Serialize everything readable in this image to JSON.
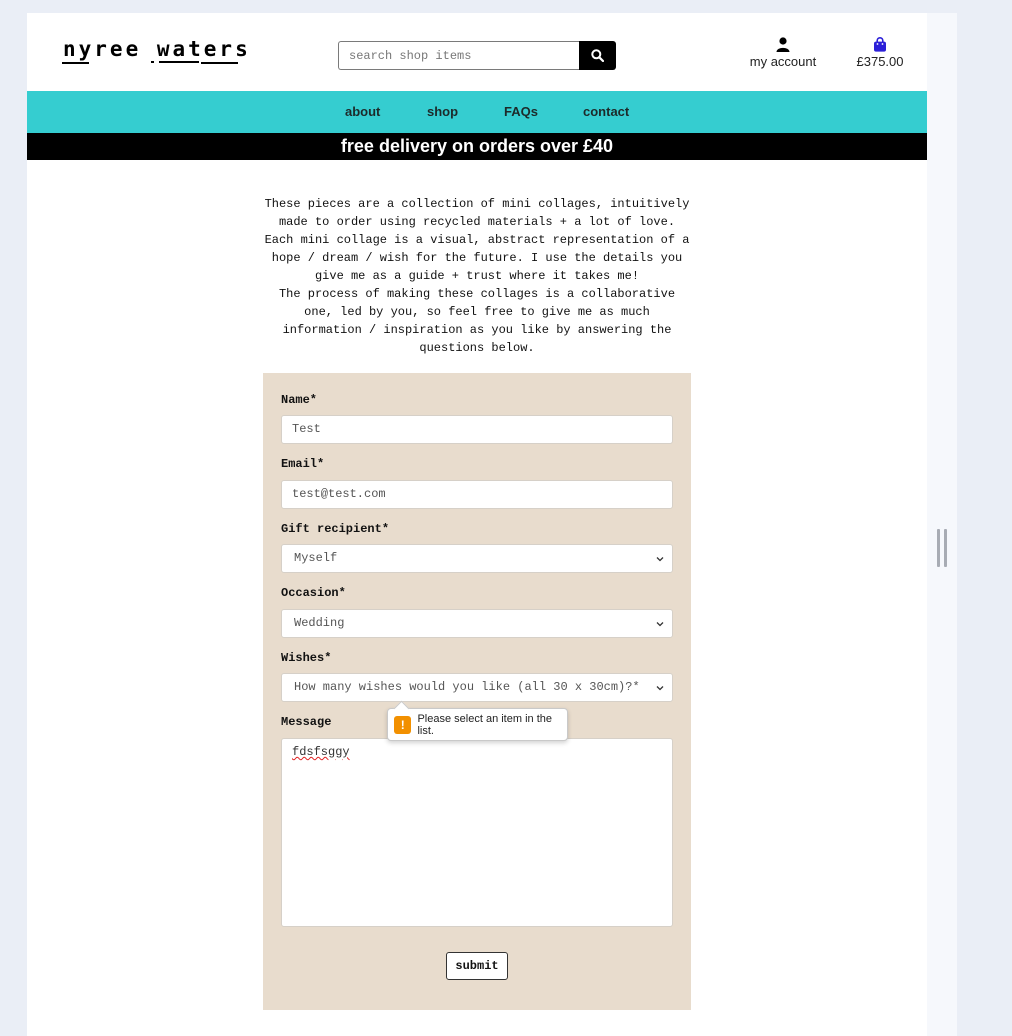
{
  "brand": {
    "logo_text": "nyree waters"
  },
  "search": {
    "placeholder": "search shop items"
  },
  "header": {
    "account_label": "my account",
    "bag_total": "£375.00"
  },
  "nav": {
    "items": [
      {
        "label": "about"
      },
      {
        "label": "shop"
      },
      {
        "label": "FAQs"
      },
      {
        "label": "contact"
      }
    ]
  },
  "banner": {
    "text": "free delivery on orders over £40"
  },
  "intro": {
    "paragraph1": "These pieces are a collection of mini collages, intuitively made to order using recycled materials + a lot of love. Each mini collage is a visual, abstract representation of a hope / dream / wish for the future. I use the details you give me as a guide + trust where it takes me!",
    "paragraph2": "The process of making these collages is a collaborative one, led by you, so feel free to give me as much information / inspiration as you like by answering the questions below."
  },
  "form": {
    "name_label": "Name*",
    "name_value": "Test",
    "email_label": "Email*",
    "email_value": "test@test.com",
    "recipient_label": "Gift recipient*",
    "recipient_value": "Myself",
    "occasion_label": "Occasion*",
    "occasion_value": "Wedding",
    "wishes_label": "Wishes*",
    "wishes_value": "How many wishes would you like (all 30 x 30cm)?*",
    "message_label": "Message",
    "message_value": "fdsfsggy",
    "submit_label": "submit"
  },
  "validation": {
    "icon": "!",
    "message": "Please select an item in the list."
  },
  "colors": {
    "nav_bg": "#35cdd0",
    "banner_bg": "#000000",
    "form_bg": "#e8dccd",
    "bag_icon": "#2b1fd8",
    "warning": "#f29000"
  }
}
